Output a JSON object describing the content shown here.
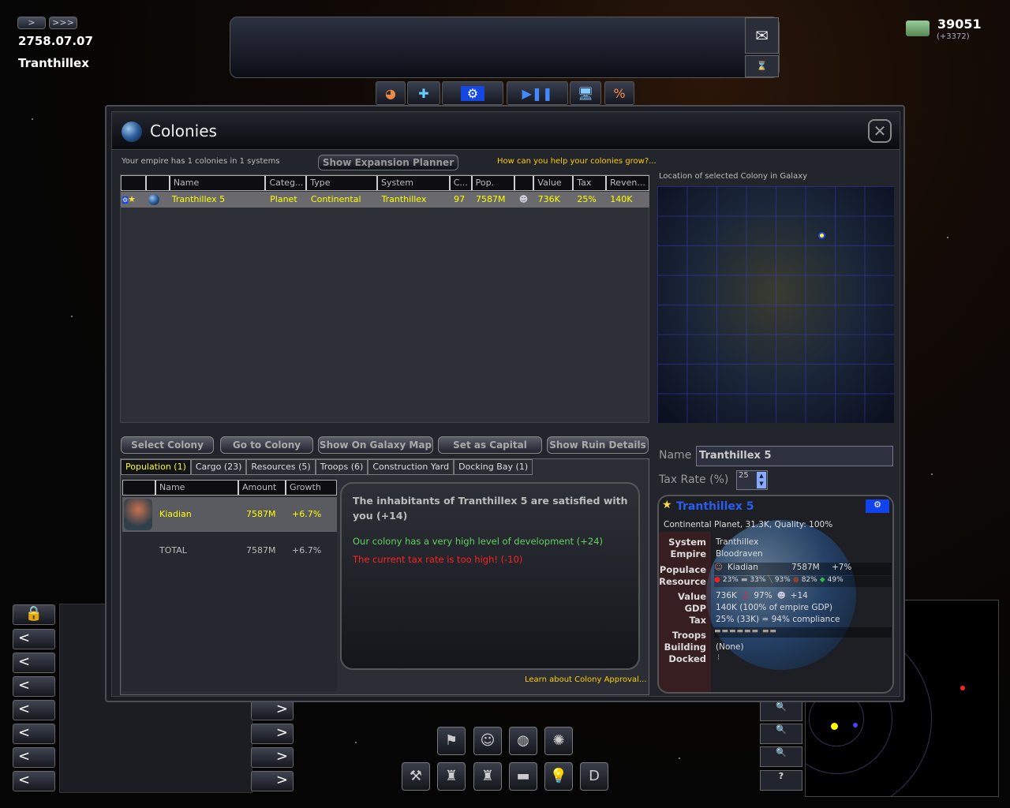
{
  "hud": {
    "speed_slow": ">",
    "speed_fast": ">>>",
    "date": "2758.07.07",
    "empire_location": "Tranthillex",
    "credits": "39051",
    "credits_delta": "(+3372)"
  },
  "dialog": {
    "title": "Colonies",
    "summary": "Your empire has 1 colonies in 1 systems",
    "expansion_button": "Show Expansion Planner",
    "help_link": "How can you help your colonies grow?...",
    "columns": [
      "Name",
      "Categ...",
      "Type",
      "System",
      "C...",
      "Pop.",
      "",
      "Value",
      "Tax",
      "Reven..."
    ],
    "rows": [
      {
        "name": "Tranthillex 5",
        "category": "Planet",
        "type": "Continental",
        "system": "Tranthillex",
        "c": "97",
        "pop": "7587M",
        "value": "736K",
        "tax": "25%",
        "revenue": "140K"
      }
    ],
    "actions": [
      "Select Colony",
      "Go to Colony",
      "Show On Galaxy Map",
      "Set as Capital",
      "Show Ruin Details"
    ],
    "tabs": [
      "Population (1)",
      "Cargo (23)",
      "Resources (5)",
      "Troops (6)",
      "Construction Yard",
      "Docking Bay (1)"
    ],
    "pop_columns": [
      "Name",
      "Amount",
      "Growth"
    ],
    "pop_rows": [
      {
        "name": "Kiadian",
        "amount": "7587M",
        "growth": "+6.7%"
      }
    ],
    "pop_total": {
      "name": "TOTAL",
      "amount": "7587M",
      "growth": "+6.7%"
    },
    "approval": {
      "headline": "The inhabitants of Tranthillex 5 are satisfied with you (+14)",
      "positive": "Our colony has a very high level of development (+24)",
      "negative": "The current tax rate is too high! (-10)",
      "link": "Learn about Colony Approval..."
    },
    "map_label": "Location of selected Colony in Galaxy",
    "name_label": "Name",
    "name_value": "Tranthillex 5",
    "tax_label": "Tax Rate (%)",
    "tax_value": "25",
    "card": {
      "title": "Tranthillex 5",
      "subtitle": "Continental Planet, 31.3K,  Quality: 100%",
      "labels": {
        "system": "System",
        "empire": "Empire",
        "populace": "Populace",
        "resource": "Resource",
        "value": "Value",
        "gdp": "GDP",
        "tax": "Tax",
        "troops": "Troops",
        "building": "Building",
        "docked": "Docked"
      },
      "system": "Tranthillex",
      "empire": "Bloodraven",
      "race": "Kiadian",
      "pop": "7587M",
      "growth": "+7%",
      "resources": [
        "23%",
        "33%",
        "93%",
        "82%",
        "49%"
      ],
      "value": "736K",
      "happiness": "97%",
      "approval": "+14",
      "gdp": "140K (100% of empire GDP)",
      "tax": "25% (33K) = 94% compliance",
      "building": "(None)"
    }
  },
  "colors": {
    "accent_yellow": "#f0e000",
    "positive": "#60d060",
    "negative": "#ff2020",
    "link": "#ffcc00"
  }
}
